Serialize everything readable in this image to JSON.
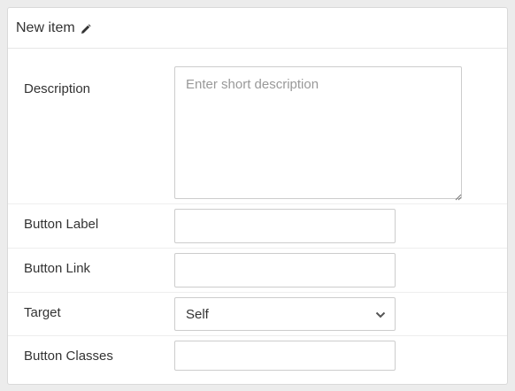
{
  "panel": {
    "title": "New item",
    "title_icon": "pencil-icon"
  },
  "form": {
    "description": {
      "label": "Description",
      "placeholder": "Enter short description",
      "value": ""
    },
    "button_label": {
      "label": "Button Label",
      "value": ""
    },
    "button_link": {
      "label": "Button Link",
      "value": ""
    },
    "target": {
      "label": "Target",
      "selected": "Self",
      "icon": "chevron-down-icon"
    },
    "button_classes": {
      "label": "Button Classes",
      "value": ""
    }
  },
  "colors": {
    "background": "#ececec",
    "panel": "#ffffff",
    "border": "#cccccc",
    "text": "#333333",
    "placeholder": "#999999"
  }
}
